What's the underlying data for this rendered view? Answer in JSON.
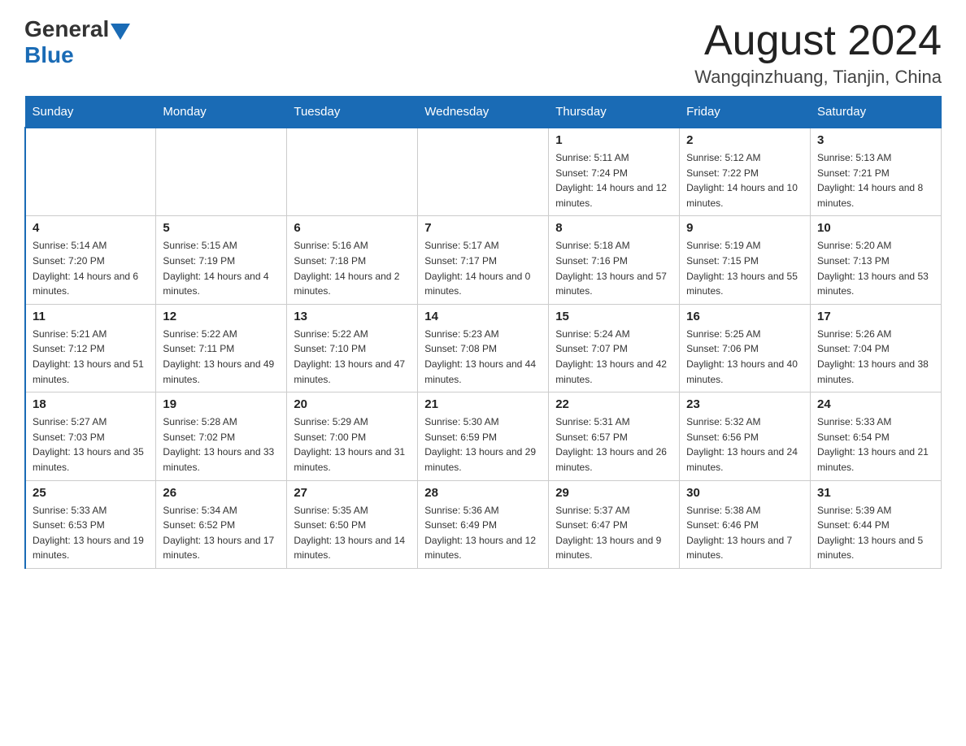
{
  "header": {
    "logo_general": "General",
    "logo_blue": "Blue",
    "month_title": "August 2024",
    "location": "Wangqinzhuang, Tianjin, China"
  },
  "weekdays": [
    "Sunday",
    "Monday",
    "Tuesday",
    "Wednesday",
    "Thursday",
    "Friday",
    "Saturday"
  ],
  "weeks": [
    [
      {
        "day": "",
        "sunrise": "",
        "sunset": "",
        "daylight": ""
      },
      {
        "day": "",
        "sunrise": "",
        "sunset": "",
        "daylight": ""
      },
      {
        "day": "",
        "sunrise": "",
        "sunset": "",
        "daylight": ""
      },
      {
        "day": "",
        "sunrise": "",
        "sunset": "",
        "daylight": ""
      },
      {
        "day": "1",
        "sunrise": "Sunrise: 5:11 AM",
        "sunset": "Sunset: 7:24 PM",
        "daylight": "Daylight: 14 hours and 12 minutes."
      },
      {
        "day": "2",
        "sunrise": "Sunrise: 5:12 AM",
        "sunset": "Sunset: 7:22 PM",
        "daylight": "Daylight: 14 hours and 10 minutes."
      },
      {
        "day": "3",
        "sunrise": "Sunrise: 5:13 AM",
        "sunset": "Sunset: 7:21 PM",
        "daylight": "Daylight: 14 hours and 8 minutes."
      }
    ],
    [
      {
        "day": "4",
        "sunrise": "Sunrise: 5:14 AM",
        "sunset": "Sunset: 7:20 PM",
        "daylight": "Daylight: 14 hours and 6 minutes."
      },
      {
        "day": "5",
        "sunrise": "Sunrise: 5:15 AM",
        "sunset": "Sunset: 7:19 PM",
        "daylight": "Daylight: 14 hours and 4 minutes."
      },
      {
        "day": "6",
        "sunrise": "Sunrise: 5:16 AM",
        "sunset": "Sunset: 7:18 PM",
        "daylight": "Daylight: 14 hours and 2 minutes."
      },
      {
        "day": "7",
        "sunrise": "Sunrise: 5:17 AM",
        "sunset": "Sunset: 7:17 PM",
        "daylight": "Daylight: 14 hours and 0 minutes."
      },
      {
        "day": "8",
        "sunrise": "Sunrise: 5:18 AM",
        "sunset": "Sunset: 7:16 PM",
        "daylight": "Daylight: 13 hours and 57 minutes."
      },
      {
        "day": "9",
        "sunrise": "Sunrise: 5:19 AM",
        "sunset": "Sunset: 7:15 PM",
        "daylight": "Daylight: 13 hours and 55 minutes."
      },
      {
        "day": "10",
        "sunrise": "Sunrise: 5:20 AM",
        "sunset": "Sunset: 7:13 PM",
        "daylight": "Daylight: 13 hours and 53 minutes."
      }
    ],
    [
      {
        "day": "11",
        "sunrise": "Sunrise: 5:21 AM",
        "sunset": "Sunset: 7:12 PM",
        "daylight": "Daylight: 13 hours and 51 minutes."
      },
      {
        "day": "12",
        "sunrise": "Sunrise: 5:22 AM",
        "sunset": "Sunset: 7:11 PM",
        "daylight": "Daylight: 13 hours and 49 minutes."
      },
      {
        "day": "13",
        "sunrise": "Sunrise: 5:22 AM",
        "sunset": "Sunset: 7:10 PM",
        "daylight": "Daylight: 13 hours and 47 minutes."
      },
      {
        "day": "14",
        "sunrise": "Sunrise: 5:23 AM",
        "sunset": "Sunset: 7:08 PM",
        "daylight": "Daylight: 13 hours and 44 minutes."
      },
      {
        "day": "15",
        "sunrise": "Sunrise: 5:24 AM",
        "sunset": "Sunset: 7:07 PM",
        "daylight": "Daylight: 13 hours and 42 minutes."
      },
      {
        "day": "16",
        "sunrise": "Sunrise: 5:25 AM",
        "sunset": "Sunset: 7:06 PM",
        "daylight": "Daylight: 13 hours and 40 minutes."
      },
      {
        "day": "17",
        "sunrise": "Sunrise: 5:26 AM",
        "sunset": "Sunset: 7:04 PM",
        "daylight": "Daylight: 13 hours and 38 minutes."
      }
    ],
    [
      {
        "day": "18",
        "sunrise": "Sunrise: 5:27 AM",
        "sunset": "Sunset: 7:03 PM",
        "daylight": "Daylight: 13 hours and 35 minutes."
      },
      {
        "day": "19",
        "sunrise": "Sunrise: 5:28 AM",
        "sunset": "Sunset: 7:02 PM",
        "daylight": "Daylight: 13 hours and 33 minutes."
      },
      {
        "day": "20",
        "sunrise": "Sunrise: 5:29 AM",
        "sunset": "Sunset: 7:00 PM",
        "daylight": "Daylight: 13 hours and 31 minutes."
      },
      {
        "day": "21",
        "sunrise": "Sunrise: 5:30 AM",
        "sunset": "Sunset: 6:59 PM",
        "daylight": "Daylight: 13 hours and 29 minutes."
      },
      {
        "day": "22",
        "sunrise": "Sunrise: 5:31 AM",
        "sunset": "Sunset: 6:57 PM",
        "daylight": "Daylight: 13 hours and 26 minutes."
      },
      {
        "day": "23",
        "sunrise": "Sunrise: 5:32 AM",
        "sunset": "Sunset: 6:56 PM",
        "daylight": "Daylight: 13 hours and 24 minutes."
      },
      {
        "day": "24",
        "sunrise": "Sunrise: 5:33 AM",
        "sunset": "Sunset: 6:54 PM",
        "daylight": "Daylight: 13 hours and 21 minutes."
      }
    ],
    [
      {
        "day": "25",
        "sunrise": "Sunrise: 5:33 AM",
        "sunset": "Sunset: 6:53 PM",
        "daylight": "Daylight: 13 hours and 19 minutes."
      },
      {
        "day": "26",
        "sunrise": "Sunrise: 5:34 AM",
        "sunset": "Sunset: 6:52 PM",
        "daylight": "Daylight: 13 hours and 17 minutes."
      },
      {
        "day": "27",
        "sunrise": "Sunrise: 5:35 AM",
        "sunset": "Sunset: 6:50 PM",
        "daylight": "Daylight: 13 hours and 14 minutes."
      },
      {
        "day": "28",
        "sunrise": "Sunrise: 5:36 AM",
        "sunset": "Sunset: 6:49 PM",
        "daylight": "Daylight: 13 hours and 12 minutes."
      },
      {
        "day": "29",
        "sunrise": "Sunrise: 5:37 AM",
        "sunset": "Sunset: 6:47 PM",
        "daylight": "Daylight: 13 hours and 9 minutes."
      },
      {
        "day": "30",
        "sunrise": "Sunrise: 5:38 AM",
        "sunset": "Sunset: 6:46 PM",
        "daylight": "Daylight: 13 hours and 7 minutes."
      },
      {
        "day": "31",
        "sunrise": "Sunrise: 5:39 AM",
        "sunset": "Sunset: 6:44 PM",
        "daylight": "Daylight: 13 hours and 5 minutes."
      }
    ]
  ]
}
